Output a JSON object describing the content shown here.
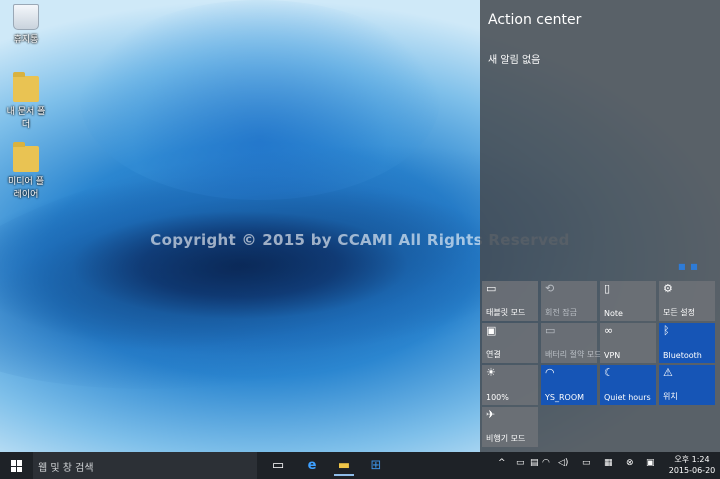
{
  "desktop": {
    "icons": [
      {
        "label": "휴지통",
        "icon": "recycle-bin-icon"
      },
      {
        "label": "내 문서 폴더",
        "icon": "folder-icon"
      },
      {
        "label": "미디어 플레이어",
        "icon": "media-folder-icon"
      }
    ],
    "watermark": "Copyright © 2015 by CCAMI All Rights Reserved"
  },
  "action_center": {
    "title": "Action center",
    "empty_text": "새 알림 없음",
    "pager_dots": "■ ■",
    "tiles": [
      {
        "label": "태블릿 모드",
        "icon": "▭",
        "on": false,
        "dim": false
      },
      {
        "label": "회전 잠금",
        "icon": "⟲",
        "on": false,
        "dim": true
      },
      {
        "label": "Note",
        "icon": "▯",
        "on": false,
        "dim": false
      },
      {
        "label": "모든 설정",
        "icon": "⚙",
        "on": false,
        "dim": false
      },
      {
        "label": "연결",
        "icon": "▣",
        "on": false,
        "dim": false
      },
      {
        "label": "배터리 절약 모드",
        "icon": "▭",
        "on": false,
        "dim": true
      },
      {
        "label": "VPN",
        "icon": "∞",
        "on": false,
        "dim": false
      },
      {
        "label": "Bluetooth",
        "icon": "ᛒ",
        "on": true,
        "dim": false
      },
      {
        "label": "100%",
        "icon": "☀",
        "on": false,
        "dim": false
      },
      {
        "label": "YS_ROOM",
        "icon": "◠",
        "on": true,
        "dim": false
      },
      {
        "label": "Quiet hours",
        "icon": "☾",
        "on": true,
        "dim": false
      },
      {
        "label": "위치",
        "icon": "⚠",
        "on": true,
        "dim": false
      },
      {
        "label": "비행기 모드",
        "icon": "✈",
        "on": false,
        "dim": false
      }
    ]
  },
  "taskbar": {
    "search_placeholder": "웹 및 창 검색",
    "apps": [
      {
        "name": "task-view",
        "glyph": "▭"
      },
      {
        "name": "edge",
        "glyph": "e"
      },
      {
        "name": "file-explorer",
        "glyph": "▬"
      },
      {
        "name": "store",
        "glyph": "⊞"
      }
    ],
    "tray_icons": [
      "^",
      "▭",
      "▤",
      "◠",
      "◁)",
      "▭",
      "▦",
      "⊗",
      "▣"
    ],
    "clock_time": "오후 1:24",
    "clock_date": "2015-06-20"
  },
  "colors": {
    "accent": "#1655b6",
    "taskbar": "#1e2227",
    "action_center_bg": "#464a50"
  }
}
